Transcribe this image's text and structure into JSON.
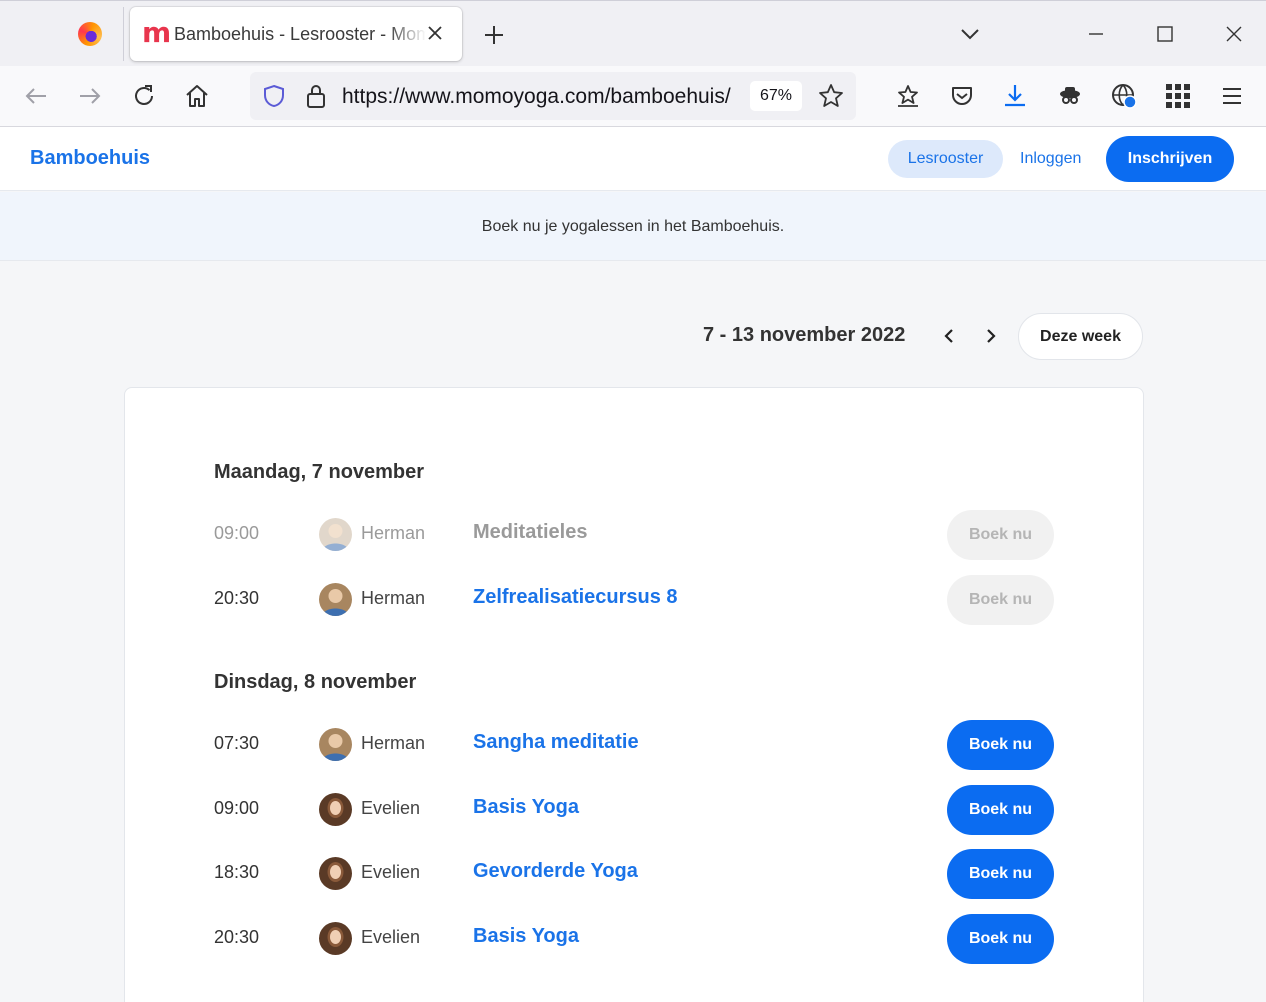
{
  "browser": {
    "tab_title": "Bamboehuis - Lesrooster - Momoyoga",
    "url": "https://www.momoyoga.com/bamboehuis/",
    "zoom": "67%"
  },
  "site": {
    "brand": "Bamboehuis",
    "nav": {
      "lesrooster": "Lesrooster",
      "inloggen": "Inloggen",
      "inschrijven": "Inschrijven"
    },
    "banner": "Boek nu je yogalessen in het Bamboehuis."
  },
  "week": {
    "range": "7 - 13 november 2022",
    "this_week_label": "Deze week"
  },
  "days": [
    {
      "heading": "Maandag, 7 november",
      "classes": [
        {
          "time": "09:00",
          "teacher": "Herman",
          "title": "Meditatieles",
          "book_label": "Boek nu",
          "state": "past"
        },
        {
          "time": "20:30",
          "teacher": "Herman",
          "title": "Zelfrealisatiecursus 8",
          "book_label": "Boek nu",
          "state": "full"
        }
      ]
    },
    {
      "heading": "Dinsdag, 8 november",
      "classes": [
        {
          "time": "07:30",
          "teacher": "Herman",
          "title": "Sangha meditatie",
          "book_label": "Boek nu",
          "state": "open"
        },
        {
          "time": "09:00",
          "teacher": "Evelien",
          "title": "Basis Yoga",
          "book_label": "Boek nu",
          "state": "open"
        },
        {
          "time": "18:30",
          "teacher": "Evelien",
          "title": "Gevorderde Yoga",
          "book_label": "Boek nu",
          "state": "open"
        },
        {
          "time": "20:30",
          "teacher": "Evelien",
          "title": "Basis Yoga",
          "book_label": "Boek nu",
          "state": "open"
        }
      ]
    }
  ],
  "colors": {
    "accent": "#0b6cf1",
    "link": "#1a73e8",
    "disabled_bg": "#f1f1f1",
    "disabled_text": "#b5b5b5"
  }
}
